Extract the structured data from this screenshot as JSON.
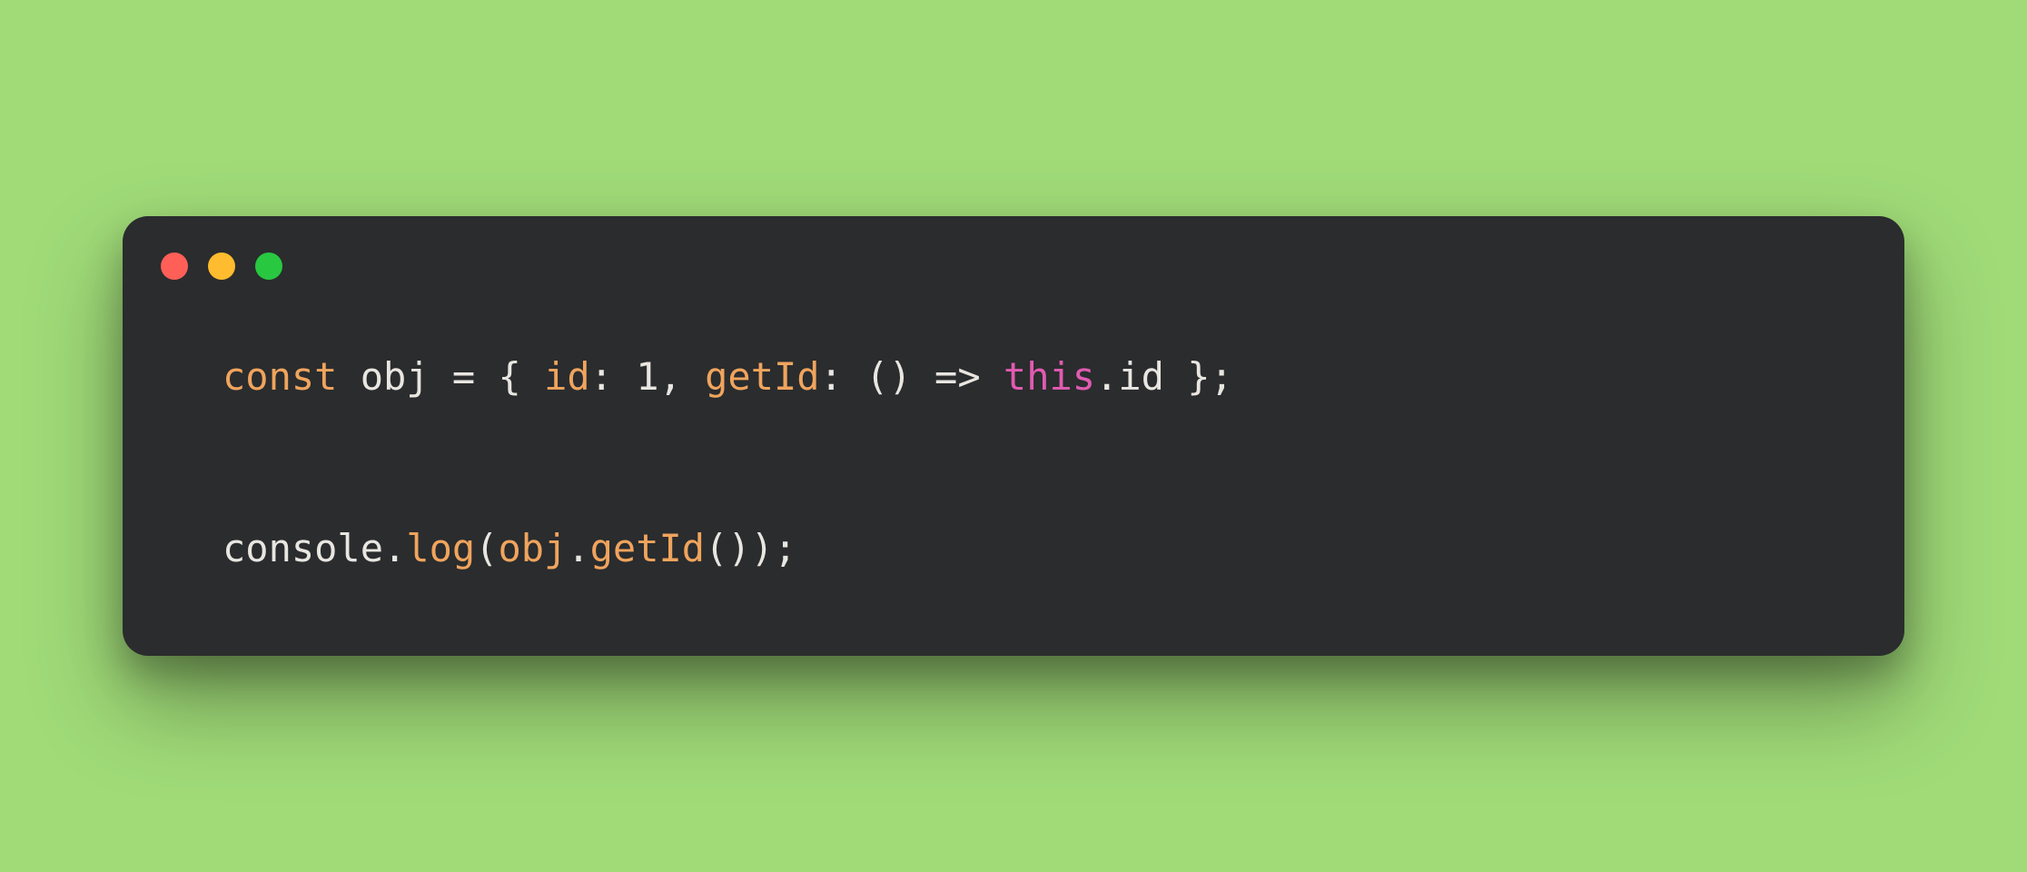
{
  "window": {
    "traffic_lights": [
      "close",
      "minimize",
      "zoom"
    ]
  },
  "code": {
    "line1": {
      "const": "const",
      "sp1": " ",
      "obj": "obj",
      "sp2": " ",
      "eq": "=",
      "sp3": " ",
      "lbrace": "{",
      "sp4": " ",
      "id_key": "id",
      "colon1": ":",
      "sp5": " ",
      "one": "1",
      "comma": ",",
      "sp6": " ",
      "getId_key": "getId",
      "colon2": ":",
      "sp7": " ",
      "parens": "()",
      "sp8": " ",
      "arrow": "=>",
      "sp9": " ",
      "this": "this",
      "dot": ".",
      "id_ref": "id",
      "sp10": " ",
      "rbrace": "}",
      "semi": ";"
    },
    "blank": "",
    "line2": {
      "console": "console",
      "dot1": ".",
      "log": "log",
      "lparen": "(",
      "obj": "obj",
      "dot2": ".",
      "getId": "getId",
      "call": "()",
      "rparen": ")",
      "semi": ";"
    }
  }
}
